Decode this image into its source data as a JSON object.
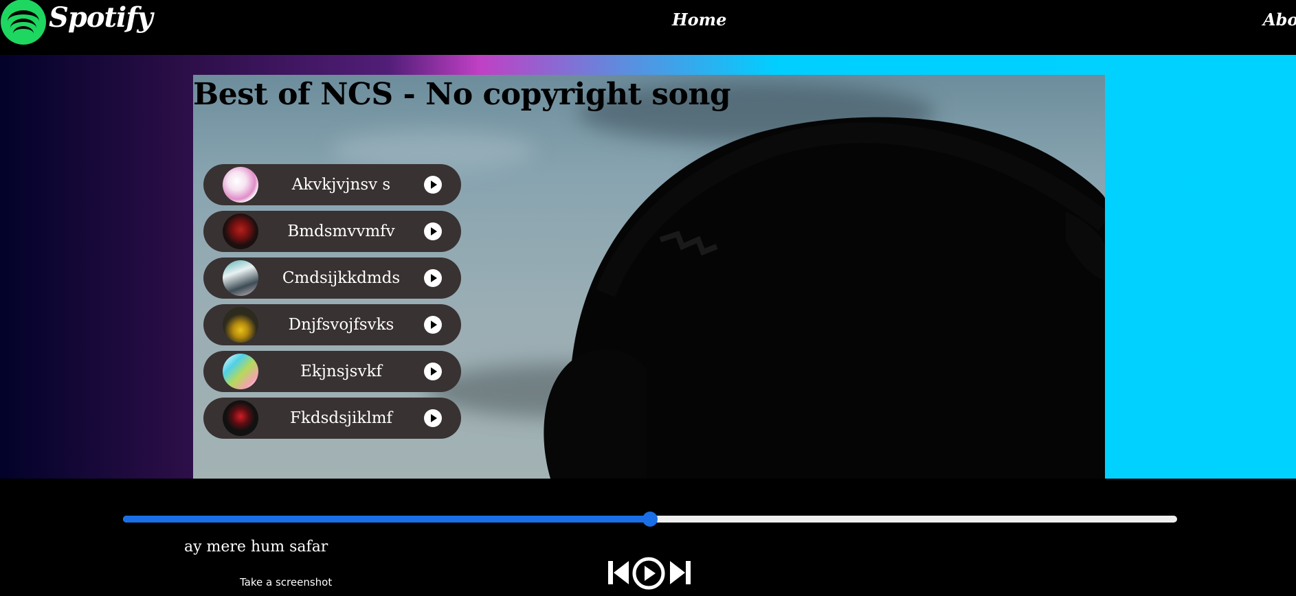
{
  "nav": {
    "brand": "Spotify",
    "links": [
      "Home",
      "About"
    ]
  },
  "hero": {
    "title": "Best of NCS - No copyright song"
  },
  "songs": [
    {
      "name": "Akvkjvjnsv s",
      "cover": "song-cover-1"
    },
    {
      "name": "Bmdsmvvmfv",
      "cover": "song-cover-2"
    },
    {
      "name": "Cmdsijkkdmds",
      "cover": "song-cover-3"
    },
    {
      "name": "Dnjfsvojfsvks",
      "cover": "song-cover-4"
    },
    {
      "name": "Ekjnsjsvkf",
      "cover": "song-cover-5"
    },
    {
      "name": "Fkdsdsjiklmf",
      "cover": "song-cover-6"
    }
  ],
  "player": {
    "now_playing": "ay mere hum safar",
    "progress": 0.5,
    "screenshot_label": "Take a screenshot",
    "icons": [
      "previous-icon",
      "play-icon",
      "next-icon"
    ]
  },
  "colors": {
    "progress_fill": "#1a6fe6",
    "progress_track": "#efefef",
    "song_item_bg": "#393232",
    "logo_green": "#1ed760",
    "hero_gradient_end": "#00d2ff"
  }
}
